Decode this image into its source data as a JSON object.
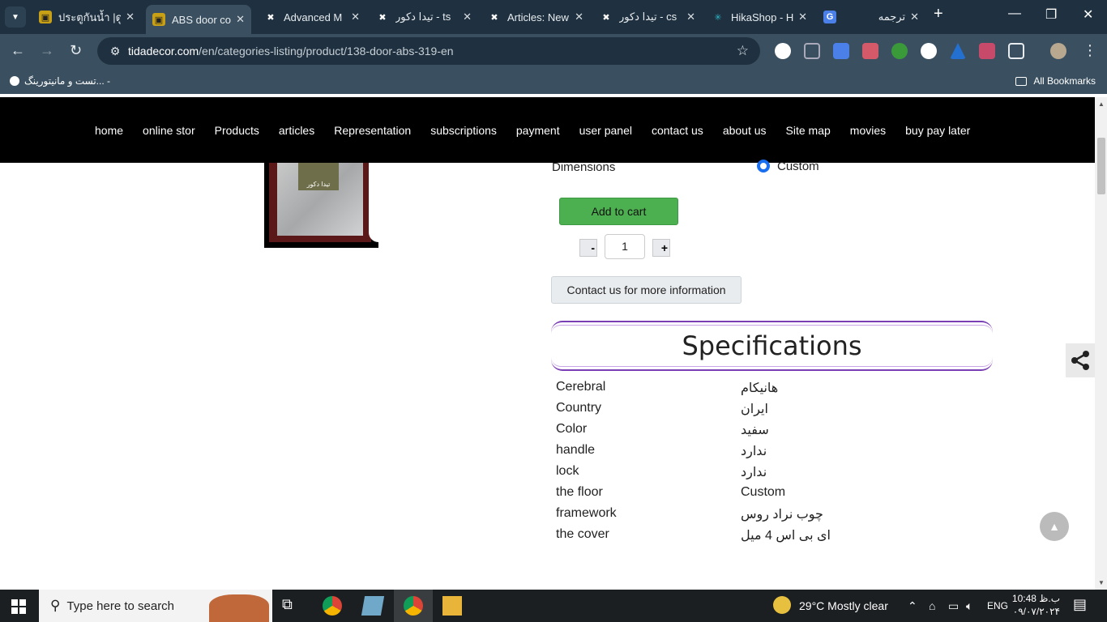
{
  "browser": {
    "tabs": [
      {
        "title": "ประตูกันน้ำ |ดู",
        "active": false
      },
      {
        "title": "ABS door co",
        "active": true
      },
      {
        "title": "Advanced M",
        "active": false
      },
      {
        "title": "تیدا دکور - ts",
        "active": false
      },
      {
        "title": "Articles: New",
        "active": false
      },
      {
        "title": "تیدا دکور - cs",
        "active": false
      },
      {
        "title": "HikaShop - H",
        "active": false
      },
      {
        "title": "ترجمه",
        "active": false
      }
    ],
    "url_host": "tidadecor.com",
    "url_path": "/en/categories-listing/product/138-door-abs-319-en",
    "bookmark_item": "تست و مانیتورینگ... -",
    "all_bookmarks": "All Bookmarks"
  },
  "site_nav": [
    "home",
    "online stor",
    "Products",
    "articles",
    "Representation",
    "subscriptions",
    "payment",
    "user panel",
    "contact us",
    "about us",
    "Site map",
    "movies",
    "buy pay later"
  ],
  "product": {
    "door_logo_text": "تیدا دکور",
    "dimensions_label": "Dimensions",
    "dimensions_option": "Custom",
    "add_to_cart": "Add to cart",
    "qty_minus": "-",
    "qty_value": "1",
    "qty_plus": "+",
    "contact_button": "Contact us for more information"
  },
  "specifications": {
    "title": "Specifications",
    "rows": [
      {
        "key": "Cerebral",
        "value": "هانیکام"
      },
      {
        "key": "Country",
        "value": "ایران"
      },
      {
        "key": "Color",
        "value": "سفید"
      },
      {
        "key": "handle",
        "value": "ندارد"
      },
      {
        "key": "lock",
        "value": "ندارد"
      },
      {
        "key": "the floor",
        "value": "Custom"
      },
      {
        "key": "framework",
        "value": "چوب نراد روس"
      },
      {
        "key": "the cover",
        "value": "ای بی اس 4 میل"
      }
    ]
  },
  "taskbar": {
    "search_placeholder": "Type here to search",
    "weather": "29°C  Mostly clear",
    "lang": "ENG",
    "time": "10:48 ب.ظ",
    "date": "۰۹/۰۷/۲۰۲۴"
  }
}
